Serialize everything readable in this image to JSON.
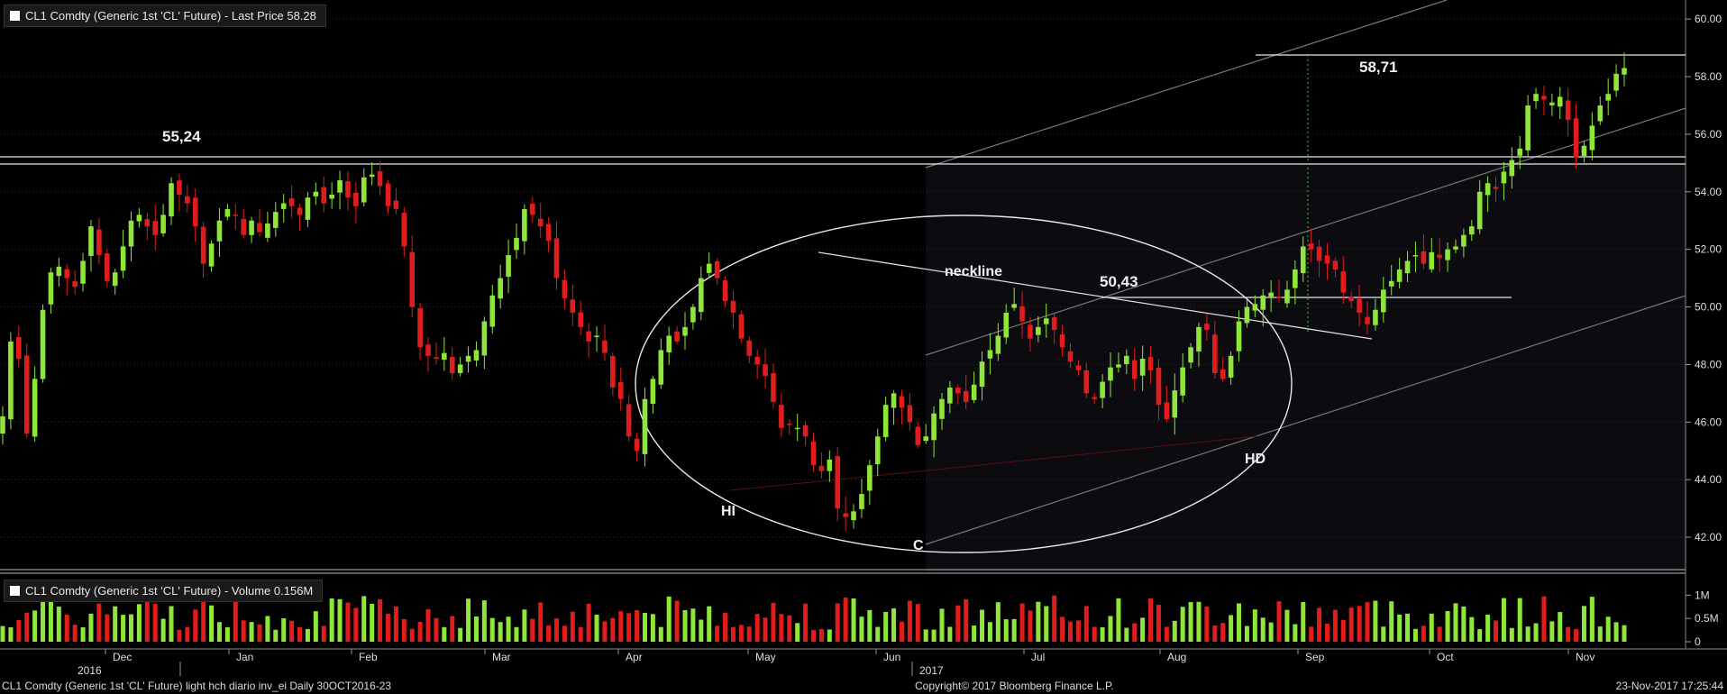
{
  "header": {
    "price_legend": "CL1 Comdty (Generic 1st 'CL' Future) - Last Price 58.28",
    "volume_legend": "CL1 Comdty (Generic 1st 'CL' Future) - Volume 0.156M"
  },
  "footer": {
    "left": "CL1 Comdty (Generic 1st 'CL' Future) light hch diario inv_ei   Daily  30OCT2016-23",
    "center": "Copyright© 2017 Bloomberg Finance L.P.",
    "right": "23-Nov-2017 17:25:44"
  },
  "colors": {
    "up": "#8ee63a",
    "down": "#e01c1c",
    "grid": "#444444",
    "background": "#000000"
  },
  "chart_data": {
    "type": "candlestick",
    "y_axis": {
      "min": 41,
      "max": 60.6,
      "ticks": [
        "60.00",
        "58.00",
        "56.00",
        "54.00",
        "52.00",
        "50.00",
        "48.00",
        "46.00",
        "44.00",
        "42.00"
      ],
      "side": "right"
    },
    "volume_axis": {
      "ticks": [
        "1M",
        "0.5M",
        "0"
      ],
      "max_millions": 1.2
    },
    "x_axis": {
      "month_labels": [
        "Dec",
        "Jan",
        "Feb",
        "Mar",
        "Apr",
        "May",
        "Jun",
        "Jul",
        "Aug",
        "Sep",
        "Oct",
        "Nov"
      ],
      "year_labels": [
        "2016",
        "2017"
      ]
    },
    "annotations": {
      "texts": [
        "55,24",
        "58,71",
        "50,43",
        "neckline",
        "HI",
        "C",
        "HD"
      ],
      "levels": [
        55.24,
        58.71,
        50.43
      ]
    },
    "closes": [
      46.2,
      48.8,
      48.2,
      45.6,
      47.5,
      49.9,
      51.2,
      51.4,
      51.0,
      50.7,
      51.6,
      52.8,
      51.8,
      50.9,
      51.2,
      52.1,
      53.0,
      53.2,
      52.8,
      52.5,
      53.2,
      54.3,
      53.9,
      53.6,
      52.8,
      51.5,
      52.2,
      53.0,
      53.4,
      53.2,
      52.5,
      53.0,
      52.6,
      52.9,
      53.3,
      53.6,
      53.5,
      53.2,
      53.8,
      54.0,
      53.6,
      53.9,
      54.4,
      53.8,
      53.5,
      54.5,
      54.6,
      54.2,
      53.5,
      53.4,
      52.1,
      50.0,
      48.6,
      48.3,
      48.2,
      48.4,
      47.7,
      48.0,
      48.3,
      48.5,
      49.5,
      50.4,
      51.0,
      51.8,
      52.4,
      53.4,
      53.2,
      52.8,
      52.3,
      51.0,
      50.3,
      49.8,
      49.3,
      48.8,
      49.0,
      48.4,
      47.2,
      46.8,
      45.5,
      45.0,
      46.8,
      47.5,
      48.5,
      49.0,
      48.8,
      49.3,
      50.0,
      51.0,
      51.5,
      51.0,
      50.2,
      49.8,
      48.9,
      48.3,
      48.0,
      47.6,
      46.7,
      45.8,
      45.9,
      45.8,
      45.5,
      44.5,
      44.3,
      44.7,
      43.0,
      42.7,
      42.9,
      43.5,
      44.5,
      45.5,
      46.6,
      47.0,
      46.5,
      46.0,
      45.2,
      45.5,
      46.3,
      46.8,
      47.2,
      47.0,
      46.7,
      47.3,
      48.1,
      48.5,
      49.0,
      49.8,
      50.1,
      49.5,
      48.9,
      49.3,
      49.6,
      49.2,
      48.6,
      48.1,
      47.8,
      47.0,
      46.8,
      47.4,
      47.9,
      48.0,
      48.3,
      47.5,
      48.2,
      47.8,
      46.6,
      46.1,
      47.1,
      47.9,
      48.6,
      49.3,
      49.2,
      47.7,
      47.5,
      48.3,
      49.5,
      50.0,
      50.1,
      50.4,
      50.5,
      50.3,
      50.6,
      51.3,
      52.1,
      52.0,
      51.6,
      51.5,
      51.3,
      50.5,
      50.2,
      49.8,
      49.4,
      49.9,
      50.6,
      50.9,
      51.3,
      51.6,
      51.8,
      51.5,
      51.9,
      51.7,
      52.0,
      52.1,
      52.5,
      52.8,
      54.0,
      54.3,
      54.1,
      54.7,
      55.1,
      55.5,
      57.0,
      57.4,
      57.2,
      57.1,
      57.3,
      56.5,
      55.2,
      55.6,
      56.3,
      57.0,
      57.4,
      58.1,
      58.3
    ],
    "annotation_points_index": {
      "HI": 68,
      "C": 102,
      "HD": 135
    }
  }
}
